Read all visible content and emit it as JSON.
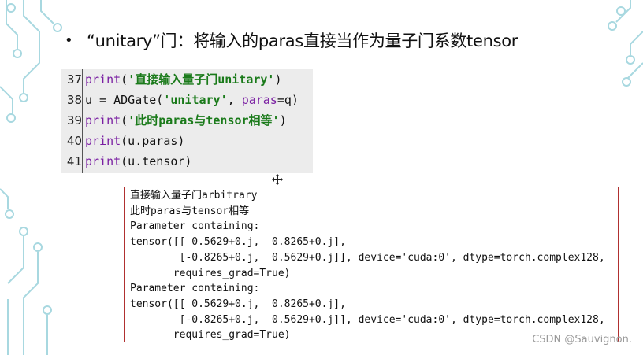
{
  "slide": {
    "bullet": "•",
    "heading": "“unitary”门：将输入的paras直接当作为量子门系数tensor"
  },
  "code": {
    "lines": [
      {
        "num": "37",
        "parts": [
          {
            "t": "print",
            "c": "kw"
          },
          {
            "t": "(",
            "c": ""
          },
          {
            "t": "'直接输入量子门unitary'",
            "c": "str"
          },
          {
            "t": ")",
            "c": ""
          }
        ]
      },
      {
        "num": "38",
        "parts": [
          {
            "t": "u = ADGate(",
            "c": ""
          },
          {
            "t": "'unitary'",
            "c": "str"
          },
          {
            "t": ", ",
            "c": ""
          },
          {
            "t": "paras",
            "c": "pm"
          },
          {
            "t": "=q)",
            "c": ""
          }
        ]
      },
      {
        "num": "39",
        "parts": [
          {
            "t": "print",
            "c": "kw"
          },
          {
            "t": "(",
            "c": ""
          },
          {
            "t": "'此时paras与tensor相等'",
            "c": "str"
          },
          {
            "t": ")",
            "c": ""
          }
        ]
      },
      {
        "num": "40",
        "parts": [
          {
            "t": "print",
            "c": "kw"
          },
          {
            "t": "(u.paras)",
            "c": ""
          }
        ]
      },
      {
        "num": "41",
        "parts": [
          {
            "t": "print",
            "c": "kw"
          },
          {
            "t": "(u.tensor)",
            "c": ""
          }
        ]
      }
    ]
  },
  "output": {
    "lines": [
      "直接输入量子门arbitrary",
      "此时paras与tensor相等",
      "Parameter containing:",
      "tensor([[ 0.5629+0.j,  0.8265+0.j],",
      "        [-0.8265+0.j,  0.5629+0.j]], device='cuda:0', dtype=torch.complex128,",
      "       requires_grad=True)",
      "Parameter containing:",
      "tensor([[ 0.5629+0.j,  0.8265+0.j],",
      "        [-0.8265+0.j,  0.5629+0.j]], device='cuda:0', dtype=torch.complex128,",
      "       requires_grad=True)"
    ]
  },
  "watermark": "CSDN @Sauvignon.",
  "colors": {
    "decoration": "#a8d8e0",
    "code_bg": "#ececec",
    "output_border": "#b03030",
    "keyword": "#7a1fa2",
    "string": "#1a7a1a"
  },
  "icons": {
    "cursor": "move-cursor-icon"
  }
}
